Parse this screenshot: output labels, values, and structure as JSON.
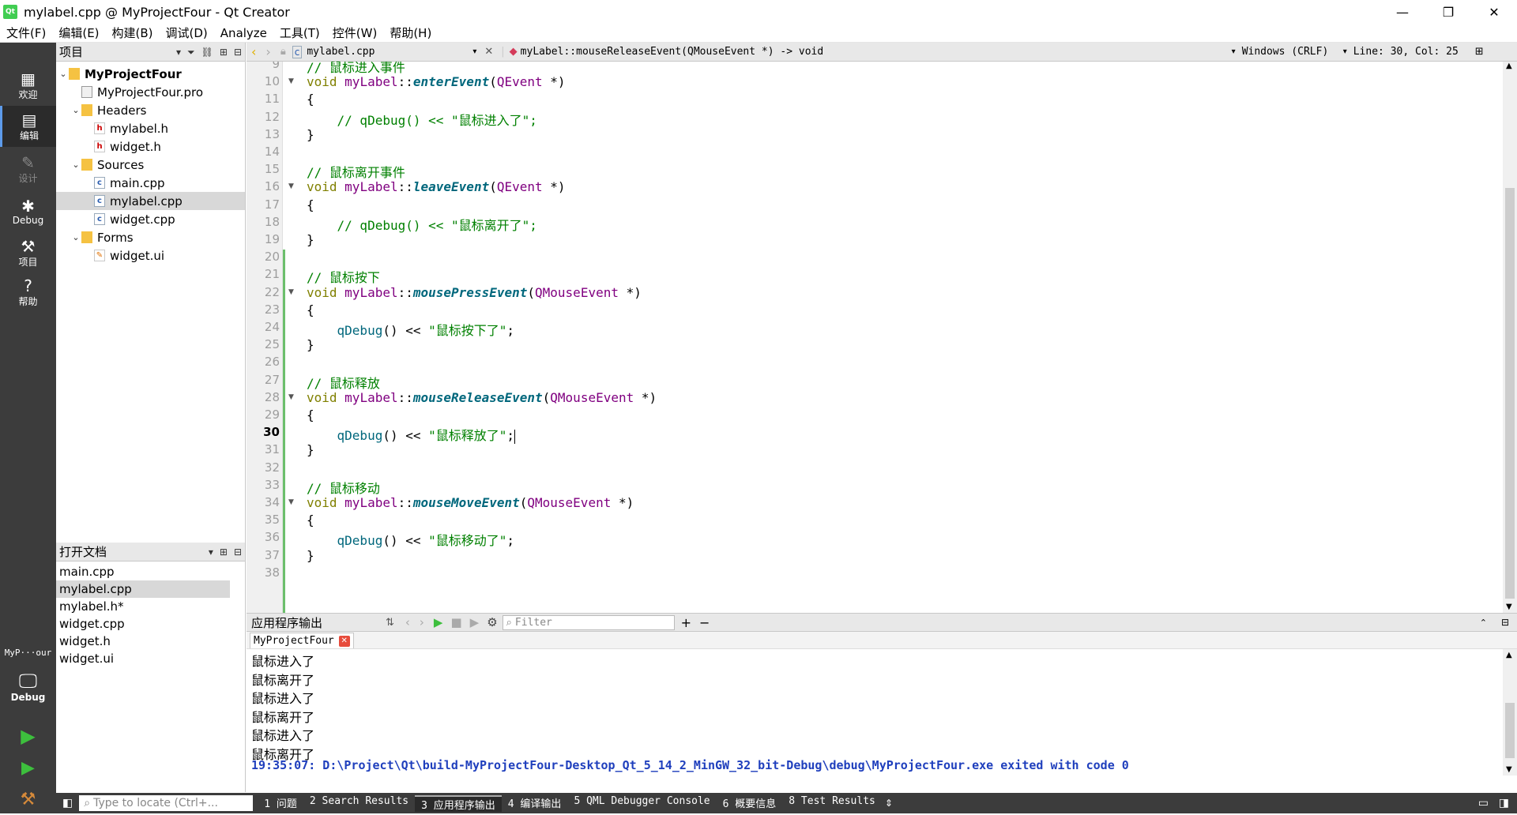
{
  "window": {
    "title": "mylabel.cpp @ MyProjectFour - Qt Creator",
    "logo": "Qt",
    "minimize": "—",
    "maximize": "❐",
    "close": "✕"
  },
  "menu": [
    "文件(F)",
    "编辑(E)",
    "构建(B)",
    "调试(D)",
    "Analyze",
    "工具(T)",
    "控件(W)",
    "帮助(H)"
  ],
  "modes": [
    {
      "label": "欢迎",
      "icon": "grid-icon"
    },
    {
      "label": "编辑",
      "icon": "edit-icon"
    },
    {
      "label": "设计",
      "icon": "pencil-icon"
    },
    {
      "label": "Debug",
      "icon": "bug-icon"
    },
    {
      "label": "项目",
      "icon": "wrench-icon"
    },
    {
      "label": "帮助",
      "icon": "help-icon"
    }
  ],
  "kit": {
    "project": "MyP···our",
    "config": "Debug"
  },
  "project_panel": {
    "title": "项目",
    "tree": [
      {
        "label": "MyProjectFour",
        "level": 0,
        "type": "project",
        "expanded": true,
        "bold": true
      },
      {
        "label": "MyProjectFour.pro",
        "level": 1,
        "type": "pro"
      },
      {
        "label": "Headers",
        "level": 1,
        "type": "folder",
        "expanded": true
      },
      {
        "label": "mylabel.h",
        "level": 2,
        "type": "h"
      },
      {
        "label": "widget.h",
        "level": 2,
        "type": "h"
      },
      {
        "label": "Sources",
        "level": 1,
        "type": "folder",
        "expanded": true
      },
      {
        "label": "main.cpp",
        "level": 2,
        "type": "cpp"
      },
      {
        "label": "mylabel.cpp",
        "level": 2,
        "type": "cpp",
        "selected": true
      },
      {
        "label": "widget.cpp",
        "level": 2,
        "type": "cpp"
      },
      {
        "label": "Forms",
        "level": 1,
        "type": "folder",
        "expanded": true
      },
      {
        "label": "widget.ui",
        "level": 2,
        "type": "ui"
      }
    ]
  },
  "open_docs": {
    "title": "打开文档",
    "items": [
      "main.cpp",
      "mylabel.cpp",
      "mylabel.h*",
      "widget.cpp",
      "widget.h",
      "widget.ui"
    ],
    "selected_index": 1
  },
  "editor_toolbar": {
    "file": "mylabel.cpp",
    "symbol": "myLabel::mouseReleaseEvent(QMouseEvent *) -> void",
    "line_ending": "Windows (CRLF)",
    "position": "Line: 30, Col: 25"
  },
  "editor": {
    "current_line": 30,
    "lines": [
      {
        "n": "9",
        "fold": false,
        "tokens": [
          {
            "c": "cm",
            "t": "// 鼠标进入事件"
          }
        ]
      },
      {
        "n": "10",
        "fold": true,
        "tokens": [
          {
            "c": "kw",
            "t": "void "
          },
          {
            "c": "cls",
            "t": "myLabel"
          },
          {
            "c": "opr",
            "t": "::"
          },
          {
            "c": "fn",
            "t": "enterEvent"
          },
          {
            "c": "opr",
            "t": "("
          },
          {
            "c": "typ",
            "t": "QEvent"
          },
          {
            "c": "opr",
            "t": " *)"
          }
        ]
      },
      {
        "n": "11",
        "fold": false,
        "tokens": [
          {
            "c": "opr",
            "t": "{"
          }
        ]
      },
      {
        "n": "12",
        "fold": false,
        "tokens": [
          {
            "c": "cm",
            "t": "    // qDebug() << \"鼠标进入了\";"
          }
        ]
      },
      {
        "n": "13",
        "fold": false,
        "tokens": [
          {
            "c": "opr",
            "t": "}"
          }
        ]
      },
      {
        "n": "14",
        "fold": false,
        "tokens": []
      },
      {
        "n": "15",
        "fold": false,
        "tokens": [
          {
            "c": "cm",
            "t": "// 鼠标离开事件"
          }
        ]
      },
      {
        "n": "16",
        "fold": true,
        "tokens": [
          {
            "c": "kw",
            "t": "void "
          },
          {
            "c": "cls",
            "t": "myLabel"
          },
          {
            "c": "opr",
            "t": "::"
          },
          {
            "c": "fn",
            "t": "leaveEvent"
          },
          {
            "c": "opr",
            "t": "("
          },
          {
            "c": "typ",
            "t": "QEvent"
          },
          {
            "c": "opr",
            "t": " *)"
          }
        ]
      },
      {
        "n": "17",
        "fold": false,
        "tokens": [
          {
            "c": "opr",
            "t": "{"
          }
        ]
      },
      {
        "n": "18",
        "fold": false,
        "tokens": [
          {
            "c": "cm",
            "t": "    // qDebug() << \"鼠标离开了\";"
          }
        ]
      },
      {
        "n": "19",
        "fold": false,
        "tokens": [
          {
            "c": "opr",
            "t": "}"
          }
        ]
      },
      {
        "n": "20",
        "fold": false,
        "tokens": []
      },
      {
        "n": "21",
        "fold": false,
        "tokens": [
          {
            "c": "cm",
            "t": "// 鼠标按下"
          }
        ]
      },
      {
        "n": "22",
        "fold": true,
        "tokens": [
          {
            "c": "kw",
            "t": "void "
          },
          {
            "c": "cls",
            "t": "myLabel"
          },
          {
            "c": "opr",
            "t": "::"
          },
          {
            "c": "fn",
            "t": "mousePressEvent"
          },
          {
            "c": "opr",
            "t": "("
          },
          {
            "c": "typ",
            "t": "QMouseEvent"
          },
          {
            "c": "opr",
            "t": " *)"
          }
        ]
      },
      {
        "n": "23",
        "fold": false,
        "tokens": [
          {
            "c": "opr",
            "t": "{"
          }
        ]
      },
      {
        "n": "24",
        "fold": false,
        "tokens": [
          {
            "c": "opr",
            "t": "    "
          },
          {
            "c": "call",
            "t": "qDebug"
          },
          {
            "c": "opr",
            "t": "() << "
          },
          {
            "c": "str",
            "t": "\"鼠标按下了\""
          },
          {
            "c": "opr",
            "t": ";"
          }
        ]
      },
      {
        "n": "25",
        "fold": false,
        "tokens": [
          {
            "c": "opr",
            "t": "}"
          }
        ]
      },
      {
        "n": "26",
        "fold": false,
        "tokens": []
      },
      {
        "n": "27",
        "fold": false,
        "tokens": [
          {
            "c": "cm",
            "t": "// 鼠标释放"
          }
        ]
      },
      {
        "n": "28",
        "fold": true,
        "tokens": [
          {
            "c": "kw",
            "t": "void "
          },
          {
            "c": "cls",
            "t": "myLabel"
          },
          {
            "c": "opr",
            "t": "::"
          },
          {
            "c": "fn",
            "t": "mouseReleaseEvent"
          },
          {
            "c": "opr",
            "t": "("
          },
          {
            "c": "typ",
            "t": "QMouseEvent"
          },
          {
            "c": "opr",
            "t": " *)"
          }
        ]
      },
      {
        "n": "29",
        "fold": false,
        "tokens": [
          {
            "c": "opr",
            "t": "{"
          }
        ]
      },
      {
        "n": "30",
        "fold": false,
        "caret": true,
        "tokens": [
          {
            "c": "opr",
            "t": "    "
          },
          {
            "c": "call",
            "t": "qDebug"
          },
          {
            "c": "opr",
            "t": "() << "
          },
          {
            "c": "str",
            "t": "\"鼠标释放了\""
          },
          {
            "c": "opr",
            "t": ";"
          }
        ]
      },
      {
        "n": "31",
        "fold": false,
        "tokens": [
          {
            "c": "opr",
            "t": "}"
          }
        ]
      },
      {
        "n": "32",
        "fold": false,
        "tokens": []
      },
      {
        "n": "33",
        "fold": false,
        "tokens": [
          {
            "c": "cm",
            "t": "// 鼠标移动"
          }
        ]
      },
      {
        "n": "34",
        "fold": true,
        "tokens": [
          {
            "c": "kw",
            "t": "void "
          },
          {
            "c": "cls",
            "t": "myLabel"
          },
          {
            "c": "opr",
            "t": "::"
          },
          {
            "c": "fn",
            "t": "mouseMoveEvent"
          },
          {
            "c": "opr",
            "t": "("
          },
          {
            "c": "typ",
            "t": "QMouseEvent"
          },
          {
            "c": "opr",
            "t": " *)"
          }
        ]
      },
      {
        "n": "35",
        "fold": false,
        "tokens": [
          {
            "c": "opr",
            "t": "{"
          }
        ]
      },
      {
        "n": "36",
        "fold": false,
        "tokens": [
          {
            "c": "opr",
            "t": "    "
          },
          {
            "c": "call",
            "t": "qDebug"
          },
          {
            "c": "opr",
            "t": "() << "
          },
          {
            "c": "str",
            "t": "\"鼠标移动了\""
          },
          {
            "c": "opr",
            "t": ";"
          }
        ]
      },
      {
        "n": "37",
        "fold": false,
        "tokens": [
          {
            "c": "opr",
            "t": "}"
          }
        ]
      },
      {
        "n": "38",
        "fold": false,
        "tokens": []
      }
    ]
  },
  "output": {
    "title": "应用程序输出",
    "filter_placeholder": "Filter",
    "tab": "MyProjectFour",
    "lines": [
      "鼠标进入了",
      "鼠标离开了",
      "鼠标进入了",
      "鼠标离开了",
      "鼠标进入了",
      "鼠标离开了"
    ],
    "exit_line": "19:35:07: D:\\Project\\Qt\\build-MyProjectFour-Desktop_Qt_5_14_2_MinGW_32_bit-Debug\\debug\\MyProjectFour.exe exited with code 0"
  },
  "statusbar": {
    "locator_placeholder": "Type to locate (Ctrl+...",
    "tabs": [
      "1 问题",
      "2 Search Results",
      "3 应用程序输出",
      "4 编译输出",
      "5 QML Debugger Console",
      "6 概要信息",
      "8 Test Results"
    ],
    "active_index": 2
  },
  "colors": {
    "mode_bar": "#3c3c3c",
    "comment": "#008000",
    "keyword": "#808000",
    "class": "#800080",
    "function": "#00677c",
    "exit_text": "#1f3fbd"
  }
}
